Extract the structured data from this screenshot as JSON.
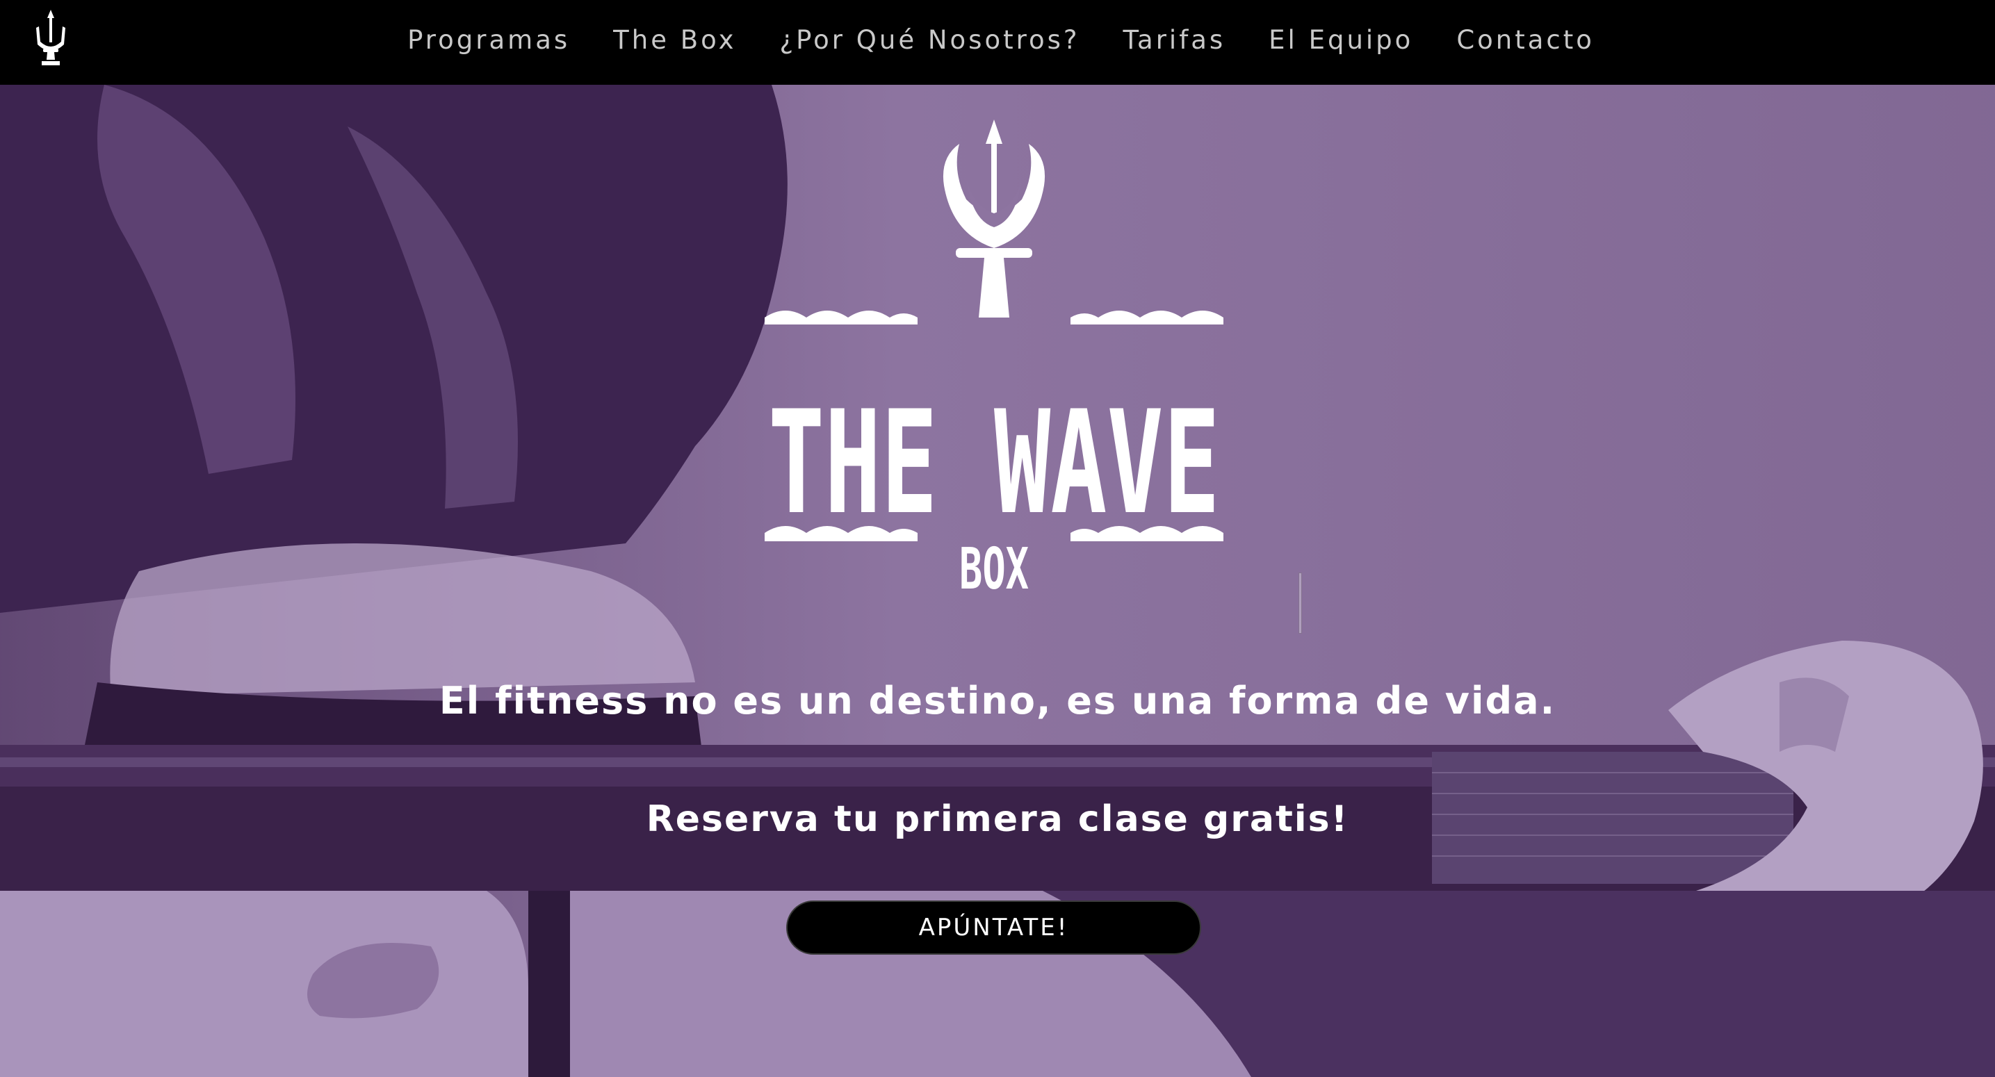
{
  "nav": {
    "items": [
      {
        "label": "Programas"
      },
      {
        "label": "The Box"
      },
      {
        "label": "¿Por Qué Nosotros?"
      },
      {
        "label": "Tarifas"
      },
      {
        "label": "El Equipo"
      },
      {
        "label": "Contacto"
      }
    ]
  },
  "hero": {
    "logo": {
      "title": "THE WAVE",
      "subtitle": "BOX"
    },
    "tagline": "El fitness no es un destino, es una forma de vida.",
    "cta_text": "Reserva tu primera clase gratis!",
    "cta_button": "APÚNTATE!"
  },
  "colors": {
    "nav_bg": "#000000",
    "hero_light": "#8d74a0",
    "hero_dark": "#3f2550",
    "text": "#ffffff",
    "nav_text": "#c9c9c9"
  },
  "icons": {
    "nav_logo": "trident-icon"
  }
}
